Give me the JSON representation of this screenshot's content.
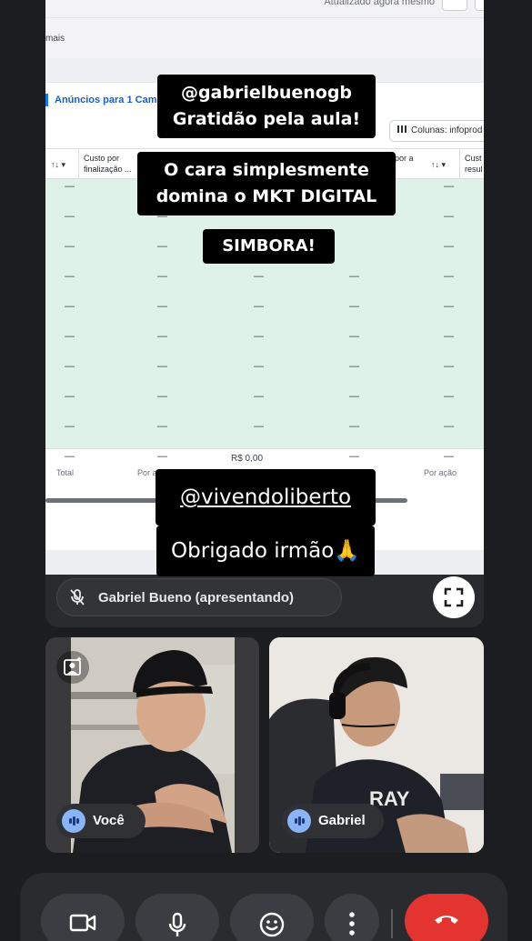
{
  "shared_screen": {
    "updated_text": "Atualizado agora mesmo",
    "more_link": "mais",
    "campaign_label": "Anúncios para 1 Camp",
    "columns_button": "Colunas: infoprod",
    "headers": {
      "col1": "Custo por finalização ...",
      "col2": "por a",
      "col3": "Cust resul"
    },
    "dash": "—",
    "totals": {
      "total_label": "Total",
      "per_action_left": "Por a",
      "value": "R$ 0,00",
      "per_action_right": "Por ação"
    }
  },
  "captions": {
    "line1": "@gabrielbuenogb",
    "line2": "Gratidão pela aula!",
    "line3": "O cara simplesmente",
    "line4": "domina o MKT DIGITAL",
    "line5": "SIMBORA!",
    "line6": "@vivendoliberto",
    "line7": "Obrigado irmão🙏"
  },
  "presenter": {
    "name": "Gabriel Bueno (apresentando)"
  },
  "participants": [
    {
      "name": "Você"
    },
    {
      "name": "Gabriel"
    }
  ],
  "colors": {
    "end_call": "#e3342f",
    "accent": "#8ab4f8",
    "table_row_bg": "#dff2ea"
  },
  "icons": [
    "mic-off-icon",
    "fullscreen-icon",
    "camera-icon",
    "mic-icon",
    "emoji-icon",
    "more-vert-icon",
    "end-call-icon",
    "frame-person-icon"
  ]
}
